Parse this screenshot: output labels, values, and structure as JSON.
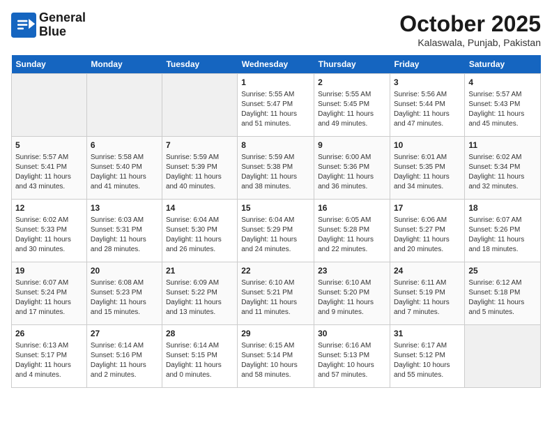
{
  "header": {
    "logo_general": "General",
    "logo_blue": "Blue",
    "month": "October 2025",
    "location": "Kalaswala, Punjab, Pakistan"
  },
  "weekdays": [
    "Sunday",
    "Monday",
    "Tuesday",
    "Wednesday",
    "Thursday",
    "Friday",
    "Saturday"
  ],
  "weeks": [
    [
      {
        "day": "",
        "info": ""
      },
      {
        "day": "",
        "info": ""
      },
      {
        "day": "",
        "info": ""
      },
      {
        "day": "1",
        "info": "Sunrise: 5:55 AM\nSunset: 5:47 PM\nDaylight: 11 hours\nand 51 minutes."
      },
      {
        "day": "2",
        "info": "Sunrise: 5:55 AM\nSunset: 5:45 PM\nDaylight: 11 hours\nand 49 minutes."
      },
      {
        "day": "3",
        "info": "Sunrise: 5:56 AM\nSunset: 5:44 PM\nDaylight: 11 hours\nand 47 minutes."
      },
      {
        "day": "4",
        "info": "Sunrise: 5:57 AM\nSunset: 5:43 PM\nDaylight: 11 hours\nand 45 minutes."
      }
    ],
    [
      {
        "day": "5",
        "info": "Sunrise: 5:57 AM\nSunset: 5:41 PM\nDaylight: 11 hours\nand 43 minutes."
      },
      {
        "day": "6",
        "info": "Sunrise: 5:58 AM\nSunset: 5:40 PM\nDaylight: 11 hours\nand 41 minutes."
      },
      {
        "day": "7",
        "info": "Sunrise: 5:59 AM\nSunset: 5:39 PM\nDaylight: 11 hours\nand 40 minutes."
      },
      {
        "day": "8",
        "info": "Sunrise: 5:59 AM\nSunset: 5:38 PM\nDaylight: 11 hours\nand 38 minutes."
      },
      {
        "day": "9",
        "info": "Sunrise: 6:00 AM\nSunset: 5:36 PM\nDaylight: 11 hours\nand 36 minutes."
      },
      {
        "day": "10",
        "info": "Sunrise: 6:01 AM\nSunset: 5:35 PM\nDaylight: 11 hours\nand 34 minutes."
      },
      {
        "day": "11",
        "info": "Sunrise: 6:02 AM\nSunset: 5:34 PM\nDaylight: 11 hours\nand 32 minutes."
      }
    ],
    [
      {
        "day": "12",
        "info": "Sunrise: 6:02 AM\nSunset: 5:33 PM\nDaylight: 11 hours\nand 30 minutes."
      },
      {
        "day": "13",
        "info": "Sunrise: 6:03 AM\nSunset: 5:31 PM\nDaylight: 11 hours\nand 28 minutes."
      },
      {
        "day": "14",
        "info": "Sunrise: 6:04 AM\nSunset: 5:30 PM\nDaylight: 11 hours\nand 26 minutes."
      },
      {
        "day": "15",
        "info": "Sunrise: 6:04 AM\nSunset: 5:29 PM\nDaylight: 11 hours\nand 24 minutes."
      },
      {
        "day": "16",
        "info": "Sunrise: 6:05 AM\nSunset: 5:28 PM\nDaylight: 11 hours\nand 22 minutes."
      },
      {
        "day": "17",
        "info": "Sunrise: 6:06 AM\nSunset: 5:27 PM\nDaylight: 11 hours\nand 20 minutes."
      },
      {
        "day": "18",
        "info": "Sunrise: 6:07 AM\nSunset: 5:26 PM\nDaylight: 11 hours\nand 18 minutes."
      }
    ],
    [
      {
        "day": "19",
        "info": "Sunrise: 6:07 AM\nSunset: 5:24 PM\nDaylight: 11 hours\nand 17 minutes."
      },
      {
        "day": "20",
        "info": "Sunrise: 6:08 AM\nSunset: 5:23 PM\nDaylight: 11 hours\nand 15 minutes."
      },
      {
        "day": "21",
        "info": "Sunrise: 6:09 AM\nSunset: 5:22 PM\nDaylight: 11 hours\nand 13 minutes."
      },
      {
        "day": "22",
        "info": "Sunrise: 6:10 AM\nSunset: 5:21 PM\nDaylight: 11 hours\nand 11 minutes."
      },
      {
        "day": "23",
        "info": "Sunrise: 6:10 AM\nSunset: 5:20 PM\nDaylight: 11 hours\nand 9 minutes."
      },
      {
        "day": "24",
        "info": "Sunrise: 6:11 AM\nSunset: 5:19 PM\nDaylight: 11 hours\nand 7 minutes."
      },
      {
        "day": "25",
        "info": "Sunrise: 6:12 AM\nSunset: 5:18 PM\nDaylight: 11 hours\nand 5 minutes."
      }
    ],
    [
      {
        "day": "26",
        "info": "Sunrise: 6:13 AM\nSunset: 5:17 PM\nDaylight: 11 hours\nand 4 minutes."
      },
      {
        "day": "27",
        "info": "Sunrise: 6:14 AM\nSunset: 5:16 PM\nDaylight: 11 hours\nand 2 minutes."
      },
      {
        "day": "28",
        "info": "Sunrise: 6:14 AM\nSunset: 5:15 PM\nDaylight: 11 hours\nand 0 minutes."
      },
      {
        "day": "29",
        "info": "Sunrise: 6:15 AM\nSunset: 5:14 PM\nDaylight: 10 hours\nand 58 minutes."
      },
      {
        "day": "30",
        "info": "Sunrise: 6:16 AM\nSunset: 5:13 PM\nDaylight: 10 hours\nand 57 minutes."
      },
      {
        "day": "31",
        "info": "Sunrise: 6:17 AM\nSunset: 5:12 PM\nDaylight: 10 hours\nand 55 minutes."
      },
      {
        "day": "",
        "info": ""
      }
    ]
  ]
}
